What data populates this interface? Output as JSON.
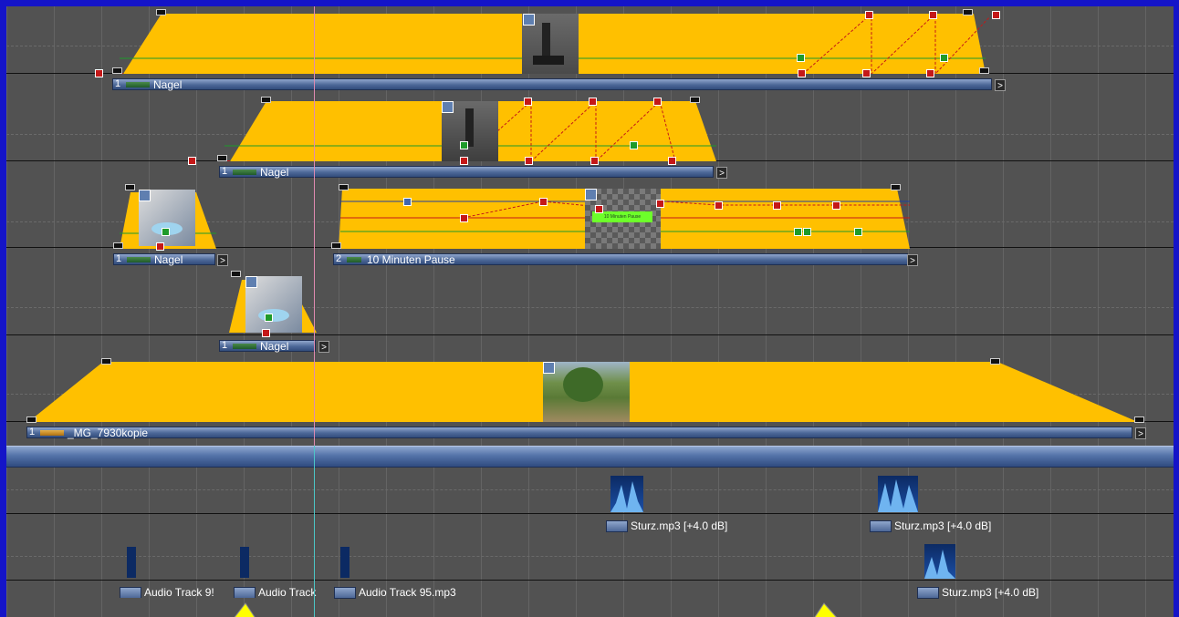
{
  "video_clips": [
    {
      "index": "1",
      "name": "Nagel"
    },
    {
      "index": "1",
      "name": "Nagel"
    },
    {
      "index": "1",
      "name": "Nagel"
    },
    {
      "index": "2",
      "name": "10 Minuten Pause"
    },
    {
      "index": "1",
      "name": "Nagel"
    },
    {
      "index": "1",
      "name": "_MG_7930kopie"
    }
  ],
  "overlay_text": "10 Minuten Pause",
  "audio_clips": [
    {
      "name": "Sturz.mp3 [+4.0 dB]"
    },
    {
      "name": "Sturz.mp3 [+4.0 dB]"
    },
    {
      "name": "Sturz.mp3 [+4.0 dB]"
    },
    {
      "name": "Audio Track 9!"
    },
    {
      "name": "Audio Track"
    },
    {
      "name": "Audio Track 95.mp3"
    }
  ],
  "end_button_glyph": ">",
  "colors": {
    "frame": "#1414c8",
    "background": "#525252",
    "clip_fill": "#ffc000",
    "keyframe_red": "#c41818",
    "keyframe_green": "#1f9a2a",
    "playhead_pink": "#e08ab0",
    "playhead_cyan": "#4cc7c7",
    "cursor_yellow": "#ffff00"
  }
}
